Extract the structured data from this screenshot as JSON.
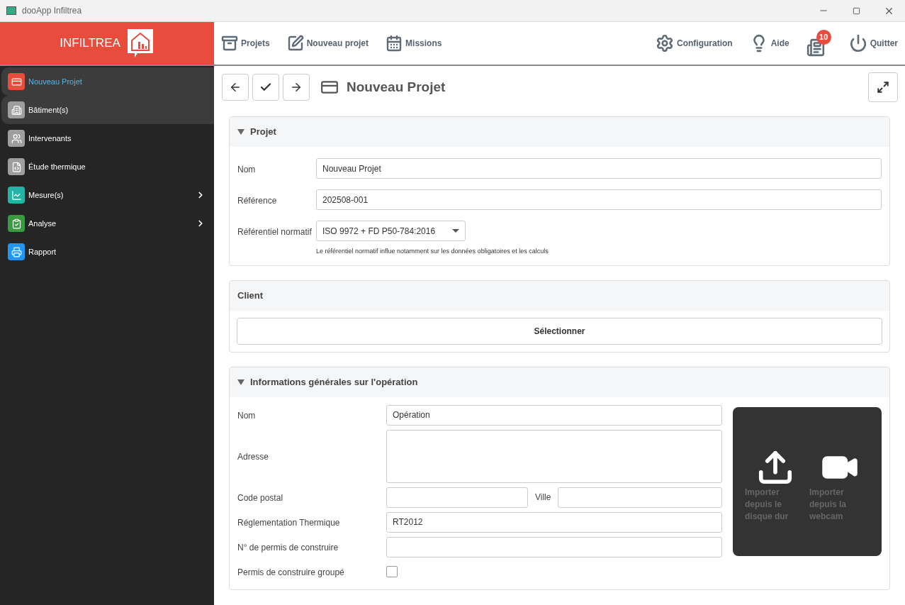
{
  "window": {
    "title": "dooApp Infiltrea"
  },
  "brand": {
    "name": "INFILTREA"
  },
  "toolbar": {
    "left": [
      {
        "kind": "cabinet",
        "label": "Projets"
      },
      {
        "kind": "edit",
        "label": "Nouveau projet"
      },
      {
        "kind": "calendar",
        "label": "Missions"
      }
    ],
    "right": [
      {
        "kind": "gear",
        "label": "Configuration"
      },
      {
        "kind": "bulb",
        "label": "Aide"
      },
      {
        "kind": "news",
        "badge": "10"
      },
      {
        "kind": "power",
        "label": "Quitter"
      }
    ]
  },
  "sidebar": {
    "items": [
      {
        "label": "Nouveau Projet",
        "kind": "card",
        "color": "#e74c3c",
        "selected": true,
        "hovered": false,
        "has_submenu": false
      },
      {
        "label": "Bâtiment(s)",
        "kind": "building",
        "color": "#9e9e9e",
        "selected": false,
        "hovered": true,
        "has_submenu": false
      },
      {
        "label": "Intervenants",
        "kind": "people",
        "color": "#9e9e9e",
        "selected": false,
        "hovered": false,
        "has_submenu": false
      },
      {
        "label": "Étude thermique",
        "kind": "file",
        "color": "#9e9e9e",
        "selected": false,
        "hovered": false,
        "has_submenu": false
      },
      {
        "label": "Mesure(s)",
        "kind": "chart",
        "color": "#26b3a6",
        "selected": false,
        "hovered": false,
        "has_submenu": true
      },
      {
        "label": "Analyse",
        "kind": "clipboard",
        "color": "#3a9a3f",
        "selected": false,
        "hovered": false,
        "has_submenu": true
      },
      {
        "label": "Rapport",
        "kind": "printer",
        "color": "#2196f3",
        "selected": false,
        "hovered": false,
        "has_submenu": false
      }
    ]
  },
  "page": {
    "title": "Nouveau Projet"
  },
  "sections": [
    {
      "kind": "projet",
      "title": "Projet",
      "collapsible": true,
      "fields": [
        {
          "kind": "text",
          "label": "Nom",
          "value": "Nouveau Projet"
        },
        {
          "kind": "text",
          "label": "Référence",
          "value": "202508-001"
        },
        {
          "kind": "select",
          "label": "Référentiel normatif",
          "value": "ISO 9972 + FD P50-784:2016",
          "hint": "Le référentiel normatif influe notamment sur les données obligatoires et les calculs"
        }
      ]
    },
    {
      "kind": "client",
      "title": "Client",
      "collapsible": false,
      "button": "Sélectionner"
    },
    {
      "kind": "operation",
      "title": "Informations générales sur l'opération",
      "collapsible": true,
      "fields": [
        {
          "kind": "text",
          "label": "Nom",
          "value": "Opération"
        },
        {
          "kind": "textarea",
          "label": "Adresse"
        },
        {
          "kind": "pair",
          "label": "Code postal",
          "label2": "Ville"
        },
        {
          "kind": "text",
          "label": "Réglementation Thermique",
          "value": "RT2012"
        },
        {
          "kind": "text",
          "label": "N° de permis de construire"
        },
        {
          "kind": "checkbox",
          "label": "Permis de construire groupé",
          "checked": false
        }
      ],
      "media": [
        {
          "kind": "upload",
          "label": "Importer depuis le disque dur"
        },
        {
          "kind": "webcam",
          "label": "Importer depuis la webcam"
        }
      ]
    }
  ]
}
